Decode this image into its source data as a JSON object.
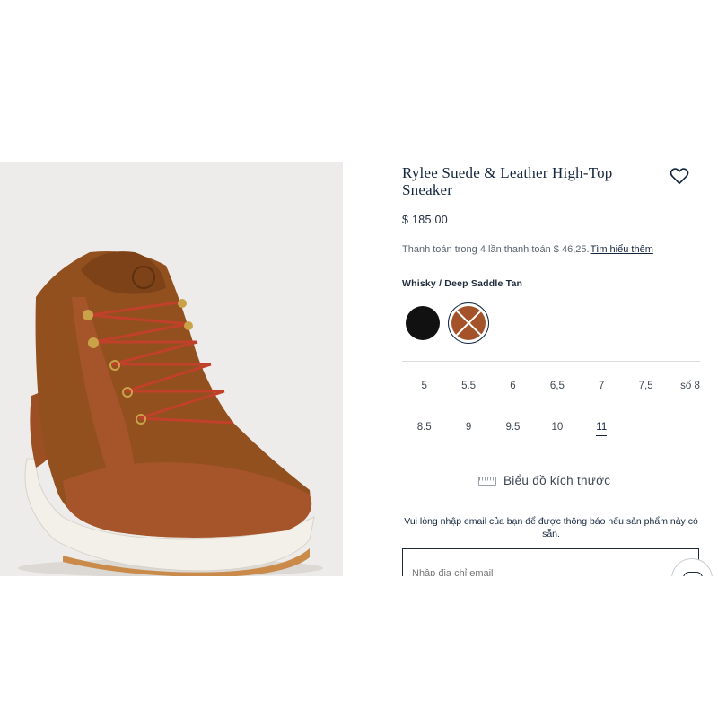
{
  "product": {
    "title": "Rylee Suede & Leather High-Top Sneaker",
    "price": "$ 185,00",
    "installment_text": "Thanh toán trong 4 lần thanh toán $ 46,25.",
    "installment_link": "Tìm hiểu thêm",
    "color_name": "Whisky / Deep Saddle Tan",
    "swatches": [
      "black",
      "whisky-brown"
    ],
    "sizes_row1": [
      "5",
      "5.5",
      "6",
      "6,5",
      "7",
      "7,5",
      "số 8"
    ],
    "sizes_row2": [
      "8.5",
      "9",
      "9.5",
      "10",
      "11"
    ],
    "selected_size": "11",
    "size_chart_label": "Biểu đồ kích thước",
    "notify_text": "Vui lòng nhập email của bạn để được thông báo nếu sản phẩm này có sẵn.",
    "email_placeholder": "Nhập địa chỉ email"
  },
  "icons": {
    "wishlist": "heart-icon",
    "size_chart": "ruler-icon",
    "chat": "chat-icon"
  },
  "colors": {
    "navy": "#14263e",
    "whisky": "#a4522a",
    "image_bg": "#eeecea"
  }
}
